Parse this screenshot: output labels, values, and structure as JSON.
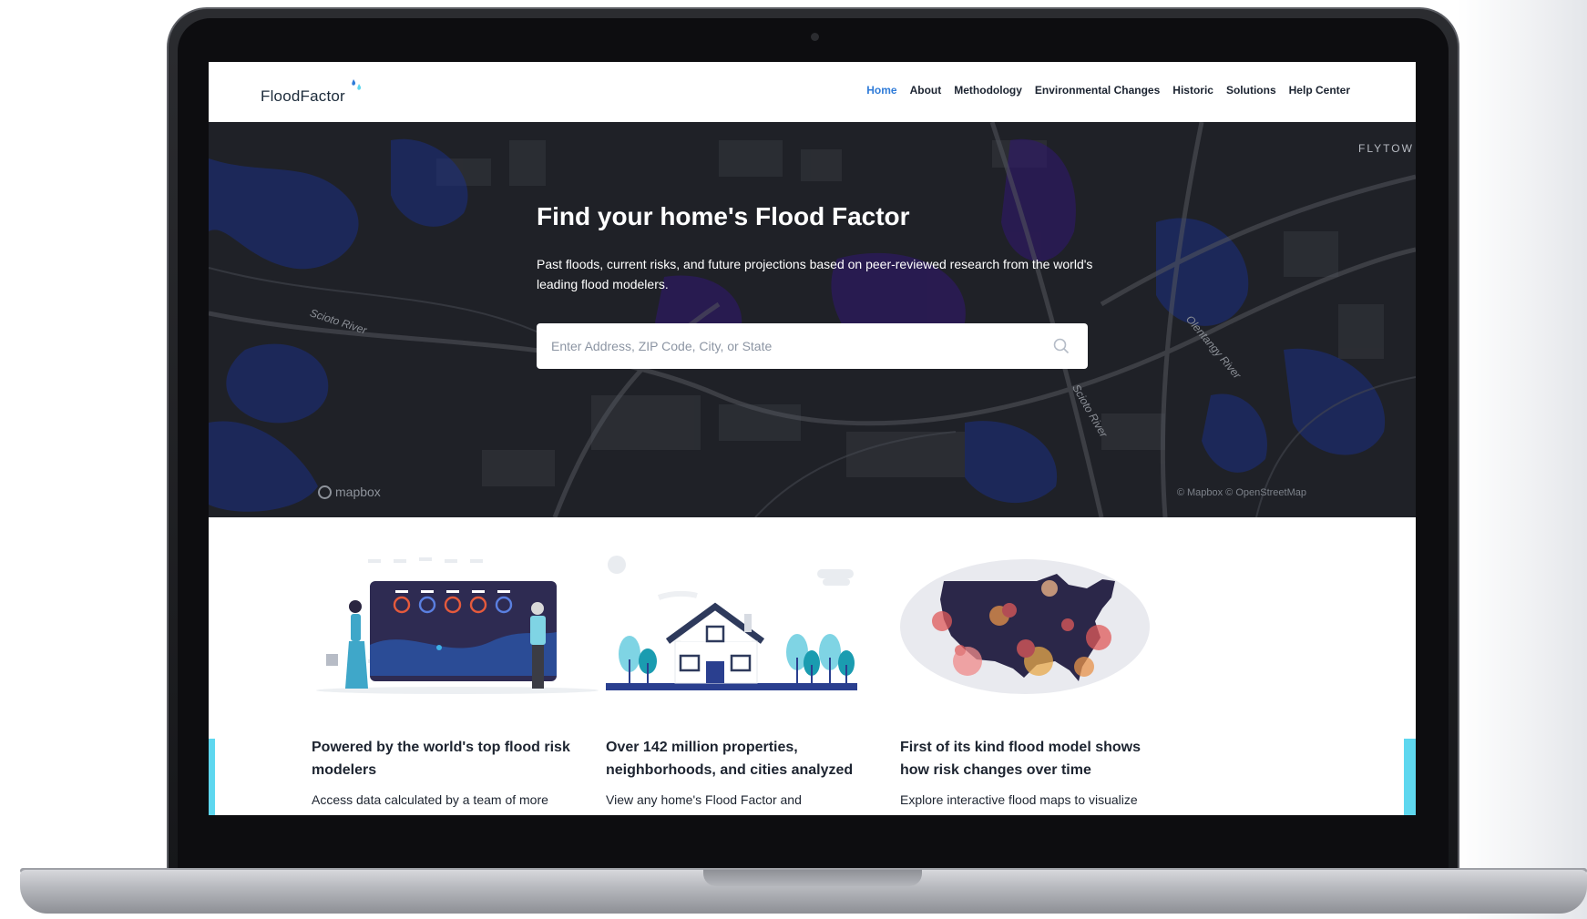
{
  "brand": {
    "logo_text": "FloodFactor",
    "primary": "#2f7bd8",
    "accent": "#5ed7ef",
    "dark": "#1b2330"
  },
  "nav": {
    "items": [
      {
        "label": "Home",
        "active": true
      },
      {
        "label": "About"
      },
      {
        "label": "Methodology"
      },
      {
        "label": "Environmental Changes"
      },
      {
        "label": "Historic"
      },
      {
        "label": "Solutions"
      },
      {
        "label": "Help Center"
      }
    ]
  },
  "hero": {
    "title": "Find your home's Flood Factor",
    "subtitle": "Past floods, current risks, and future projections based on peer-reviewed research from the world's leading flood modelers.",
    "search_placeholder": "Enter Address, ZIP Code, City, or State",
    "search_icon": "search-icon",
    "map_credit_logo": "mapbox",
    "map_attribution": "© Mapbox © OpenStreetMap",
    "map_labels": [
      "Scioto River",
      "Scioto River",
      "Olentangy River",
      "FLYTOW"
    ]
  },
  "features": [
    {
      "icon": "team-dashboard-illustration",
      "title": "Powered by the world's top flood risk modelers",
      "text": "Access data calculated by a team of more"
    },
    {
      "icon": "house-illustration",
      "title": "Over 142 million properties, neighborhoods, and cities analyzed",
      "text": "View any home's Flood Factor and"
    },
    {
      "icon": "us-map-illustration",
      "title": "First of its kind flood model shows how risk changes over time",
      "text": "Explore interactive flood maps to visualize"
    }
  ]
}
